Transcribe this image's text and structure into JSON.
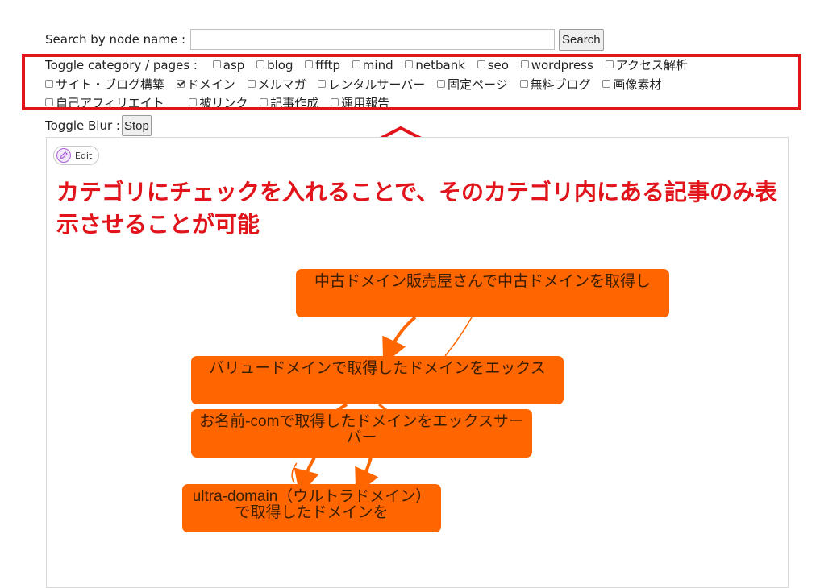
{
  "search": {
    "label": "Search by node name :",
    "input_value": "",
    "placeholder": "",
    "button_label": "Search"
  },
  "toggle": {
    "label": "Toggle category / pages :",
    "categories": [
      {
        "label": "asp",
        "checked": false
      },
      {
        "label": "blog",
        "checked": false
      },
      {
        "label": "ffftp",
        "checked": false
      },
      {
        "label": "mind",
        "checked": false
      },
      {
        "label": "netbank",
        "checked": false
      },
      {
        "label": "seo",
        "checked": false
      },
      {
        "label": "wordpress",
        "checked": false
      },
      {
        "label": "アクセス解析",
        "checked": false
      },
      {
        "label": "サイト・ブログ構築",
        "checked": false
      },
      {
        "label": "ドメイン",
        "checked": true
      },
      {
        "label": "メルマガ",
        "checked": false
      },
      {
        "label": "レンタルサーバー",
        "checked": false
      },
      {
        "label": "固定ページ",
        "checked": false
      },
      {
        "label": "無料ブログ",
        "checked": false
      },
      {
        "label": "画像素材",
        "checked": false
      },
      {
        "label": "自己アフィリエイト",
        "checked": false
      },
      {
        "label": "被リンク",
        "checked": false
      },
      {
        "label": "記事作成",
        "checked": false
      },
      {
        "label": "運用報告",
        "checked": false
      }
    ]
  },
  "blur": {
    "label": "Toggle Blur :",
    "button_label": "Stop"
  },
  "edit": {
    "label": "Edit"
  },
  "annotation": {
    "text": "カテゴリにチェックを入れることで、そのカテゴリ内にある記事のみ表示させることが可能"
  },
  "graph": {
    "nodes": [
      {
        "id": "n1",
        "label": "中古ドメイン販売屋さんで中古ドメインを取得し"
      },
      {
        "id": "n2",
        "label": "バリュードメインで取得したドメインをエックス"
      },
      {
        "id": "n3",
        "label": "お名前-comで取得したドメインをエックスサーバー"
      },
      {
        "id": "n4",
        "label": "ultra-domain（ウルトラドメイン）で取得したドメインを"
      }
    ]
  },
  "colors": {
    "highlight": "#e1141b",
    "node_fill": "#ff6600",
    "annotation_text": "#e1141b"
  }
}
